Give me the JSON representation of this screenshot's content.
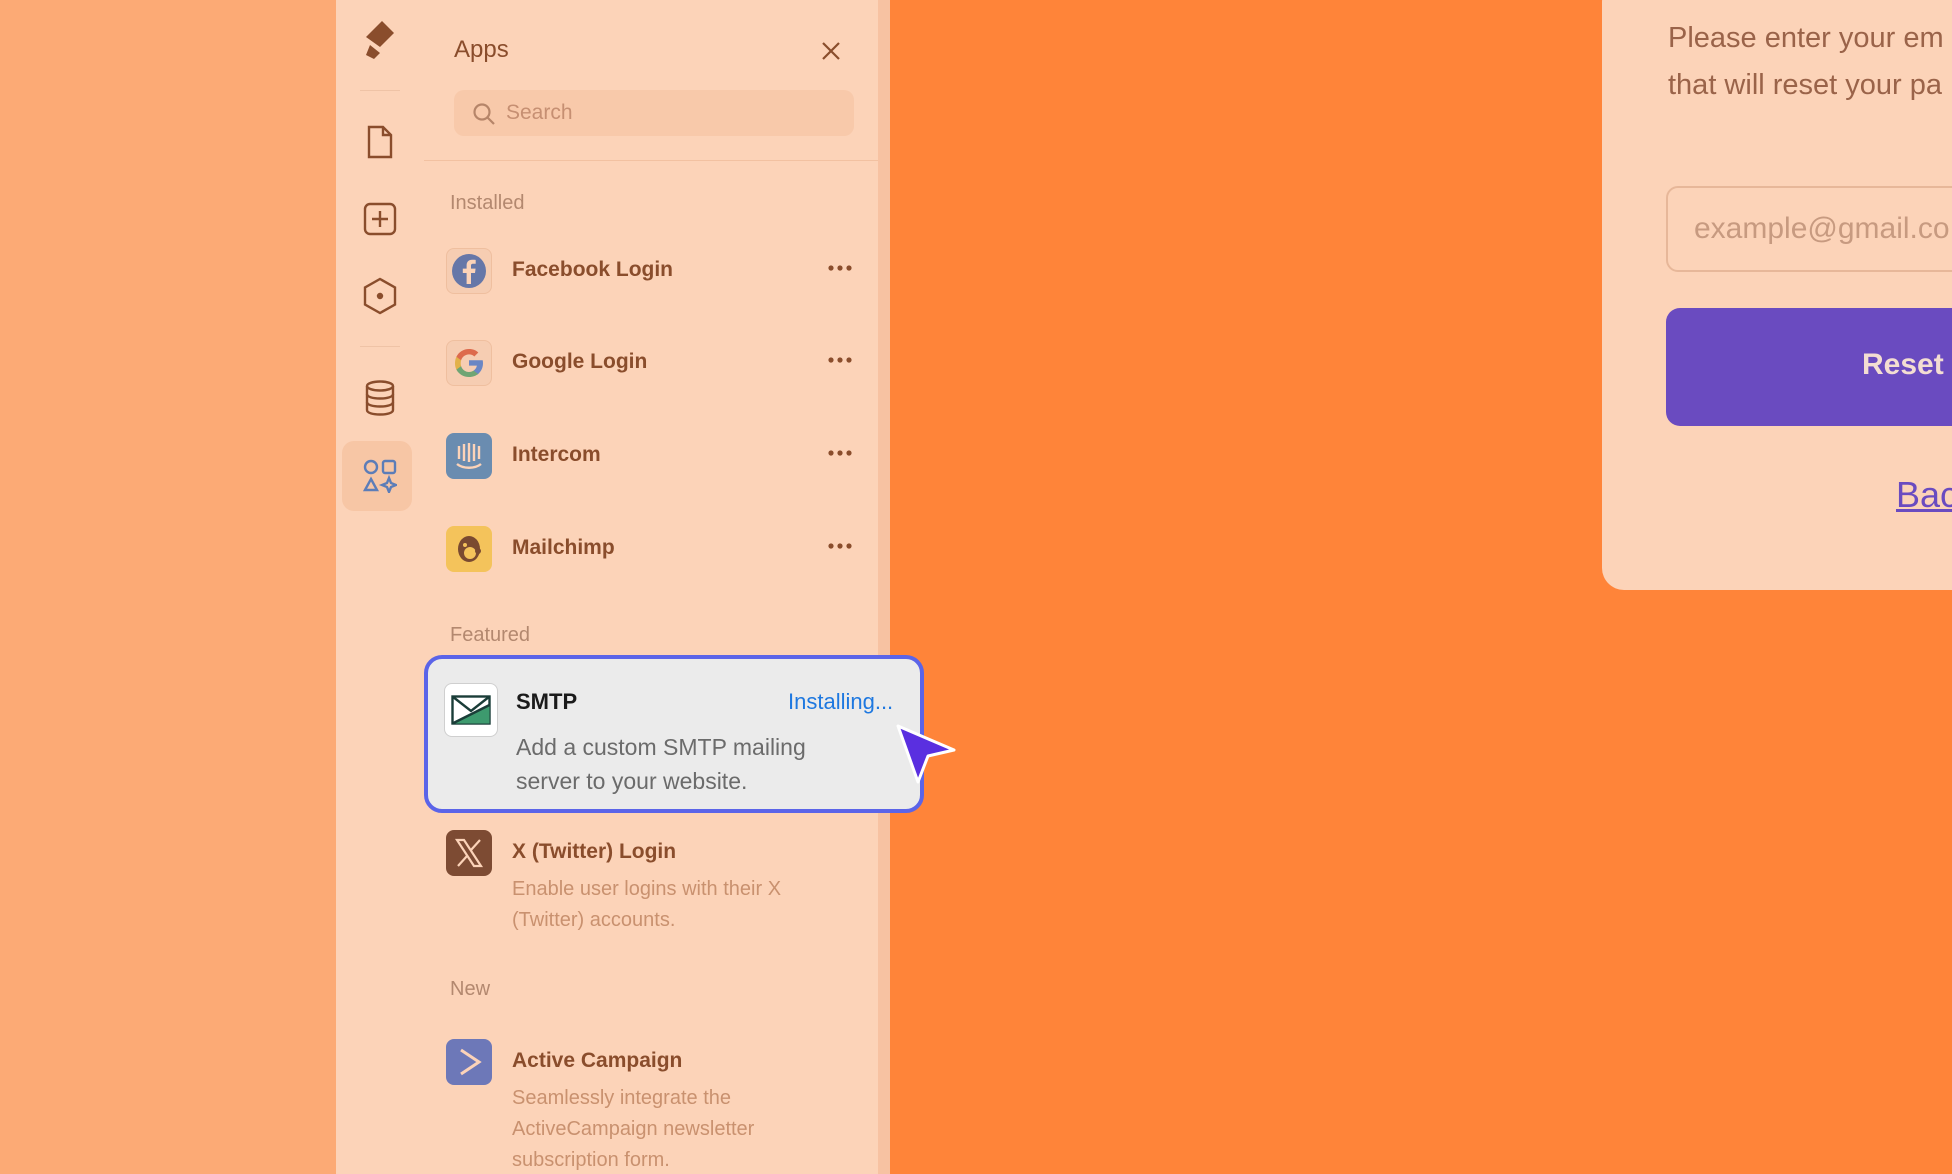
{
  "panel": {
    "title": "Apps",
    "search_placeholder": "Search"
  },
  "sections": {
    "installed": "Installed",
    "featured": "Featured",
    "new": "New"
  },
  "installed_apps": [
    {
      "name": "Facebook Login",
      "icon": "facebook-icon"
    },
    {
      "name": "Google Login",
      "icon": "google-icon"
    },
    {
      "name": "Intercom",
      "icon": "intercom-icon"
    },
    {
      "name": "Mailchimp",
      "icon": "mailchimp-icon"
    }
  ],
  "featured_apps": [
    {
      "name": "SMTP",
      "status": "Installing...",
      "description": "Add a custom SMTP mailing server to your website.",
      "icon": "smtp-mail-icon"
    },
    {
      "name": "X (Twitter) Login",
      "description": "Enable user logins with their X (Twitter) accounts.",
      "icon": "x-twitter-icon"
    }
  ],
  "new_apps": [
    {
      "name": "Active Campaign",
      "description": "Seamlessly integrate the ActiveCampaign newsletter subscription form.",
      "icon": "activecampaign-icon"
    }
  ],
  "rail_icons": [
    "logo-icon",
    "page-icon",
    "add-icon",
    "component-icon",
    "database-icon",
    "apps-icon"
  ],
  "form": {
    "line1": "Please enter your em",
    "line2": "that will reset your pa",
    "email_placeholder": "example@gmail.co",
    "reset_label": "Reset",
    "back_label": "Bac"
  },
  "colors": {
    "accent": "#5b64e8",
    "status_installing": "#1e78e0",
    "primary_button": "#6a4bc0",
    "canvas": "#ff8439"
  }
}
